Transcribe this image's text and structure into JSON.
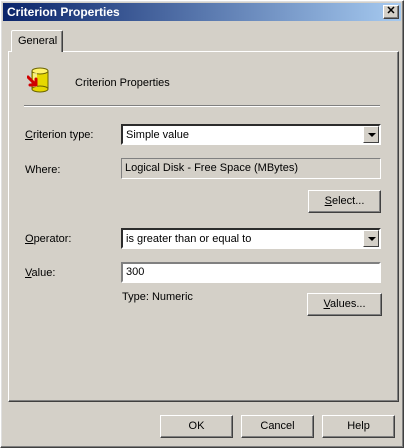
{
  "window": {
    "title": "Criterion Properties",
    "close_glyph": "✕"
  },
  "tabs": [
    {
      "label": "General"
    }
  ],
  "header": {
    "icon": "database-cylinder-icon",
    "text": "Criterion Properties"
  },
  "criterion_type": {
    "label_mnemonic": "C",
    "label_rest": "riterion type:",
    "value": "Simple value"
  },
  "where": {
    "label": "Where:",
    "value": "Logical Disk - Free Space (MBytes)"
  },
  "select_button": {
    "mnemonic": "S",
    "rest": "elect..."
  },
  "operator": {
    "label_mnemonic": "O",
    "label_rest": "perator:",
    "value": "is greater than or equal to"
  },
  "value": {
    "label_mnemonic": "V",
    "label_rest": "alue:",
    "value": "300",
    "type_text": "Type: Numeric"
  },
  "values_button": {
    "mnemonic": "V",
    "rest": "alues..."
  },
  "footer": {
    "ok": "OK",
    "cancel": "Cancel",
    "help": "Help"
  },
  "colors": {
    "title_start": "#0a246a",
    "title_end": "#a6caf0",
    "face": "#d4d0c8"
  }
}
